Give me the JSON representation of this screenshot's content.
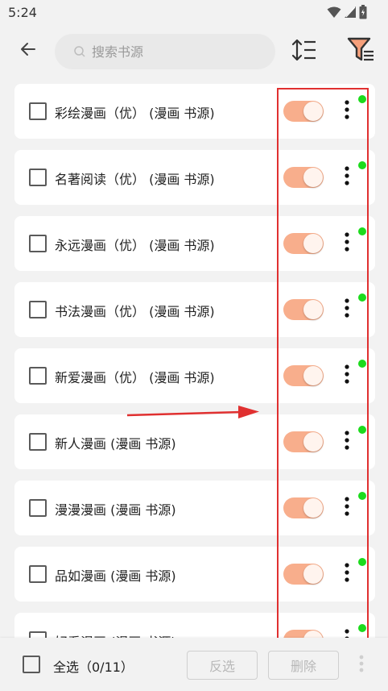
{
  "status_bar": {
    "time": "5:24"
  },
  "header": {
    "search_placeholder": "搜索书源"
  },
  "colors": {
    "toggle_on": "#f8ae8c",
    "enabled_dot": "#1cdb1c",
    "highlight": "#e03030"
  },
  "sources": [
    {
      "label": "彩绘漫画（优） (漫画 书源)",
      "enabled": true,
      "checked": false
    },
    {
      "label": "名著阅读（优） (漫画 书源)",
      "enabled": true,
      "checked": false
    },
    {
      "label": "永远漫画（优） (漫画 书源)",
      "enabled": true,
      "checked": false
    },
    {
      "label": "书法漫画（优） (漫画 书源)",
      "enabled": true,
      "checked": false
    },
    {
      "label": "新爱漫画（优） (漫画 书源)",
      "enabled": true,
      "checked": false
    },
    {
      "label": "新人漫画 (漫画 书源)",
      "enabled": true,
      "checked": false
    },
    {
      "label": "漫漫漫画 (漫画 书源)",
      "enabled": true,
      "checked": false
    },
    {
      "label": "品如漫画 (漫画 书源)",
      "enabled": true,
      "checked": false
    },
    {
      "label": "好看漫画 (漫画 书源)",
      "enabled": true,
      "checked": false
    }
  ],
  "bottom_bar": {
    "select_all_label": "全选（0/11）",
    "invert_label": "反选",
    "delete_label": "删除"
  }
}
